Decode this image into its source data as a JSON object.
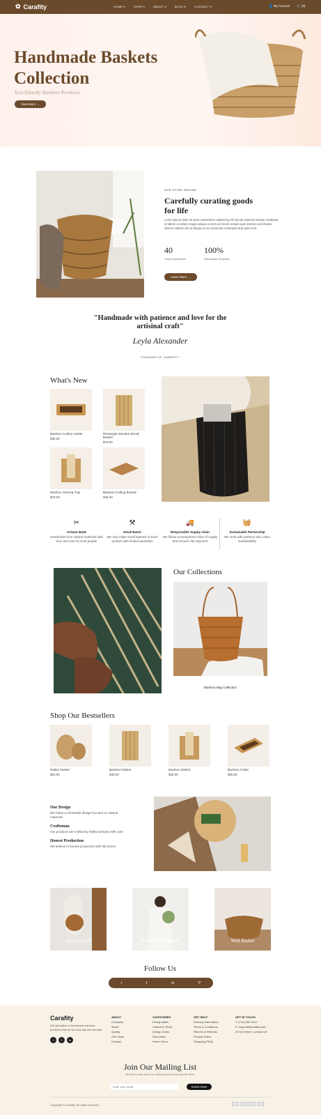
{
  "brand": "Carafity",
  "nav": [
    "HOME ▾",
    "SHOP ▾",
    "ABOUT ▾",
    "BLOG ▾",
    "CONTACT ▾"
  ],
  "header": {
    "account": "My Account",
    "cart": "(0)"
  },
  "hero": {
    "title": "Handmade Baskets Collection",
    "subtitle": "Eco-friendly Bamboo Products",
    "button": "View More →"
  },
  "about": {
    "kicker": "OUR STORY BEHIND",
    "title": "Carefully curating goods for life",
    "body": "Lorem ipsum dolor sit amet consectetur adipiscing elit sed do eiusmod tempor incididunt ut labore et dolore magna aliqua ut enim ad minim veniam quis nostrud exercitation ullamco laboris nisi ut aliquip ex ea commodo consequat duis aute irure.",
    "stat1": {
      "value": "40",
      "label": "Years Experience"
    },
    "stat2": {
      "value": "100%",
      "label": "Handmade Products"
    },
    "button": "Learn More →"
  },
  "quote": {
    "text": "\"Handmade with patience and love for the artisinal craft\"",
    "signature": "Leyla Alexander",
    "attribution": "FOUNDER OF CARAFITY"
  },
  "whats_new": {
    "title": "What's New",
    "items": [
      {
        "name": "Bamboo Cutlery Holder",
        "price": "$35.00"
      },
      {
        "name": "Rectangle Wooden Bread Basket",
        "price": "$78.00"
      },
      {
        "name": "Bamboo Serving Tray",
        "price": "$78.00"
      },
      {
        "name": "Bamboo Cutting Boards",
        "price": "$45.00"
      }
    ]
  },
  "features": [
    {
      "icon": "scissors-icon",
      "glyph": "✂",
      "title": "Artisan Made",
      "text": "Handmade from natural materials with love and care by local people"
    },
    {
      "icon": "tools-icon",
      "glyph": "⚒",
      "title": "Small Batch",
      "text": "We only make small batches of each product with limited quantities"
    },
    {
      "icon": "truck-icon",
      "glyph": "🚚",
      "title": "Responsible Supply chain",
      "text": "We follow a transparent chain of supply that ensures fair payment"
    },
    {
      "icon": "basket-icon",
      "glyph": "🧺",
      "title": "Sustainable Partnership",
      "text": "We work with partners who value sustainability"
    }
  ],
  "collections": {
    "title": "Our Collections",
    "caption": "Bamboo Bag Collection"
  },
  "bestsellers": {
    "title": "Shop Our Bestsellers",
    "items": [
      {
        "name": "Rattan basket",
        "price": "$24.00"
      },
      {
        "name": "Bamboo basket",
        "price": "$45.00"
      },
      {
        "name": "Bamboo basket",
        "price": "$45.00"
      },
      {
        "name": "Bamboo holder",
        "price": "$35.00"
      }
    ]
  },
  "values": [
    {
      "title": "Our Design",
      "text": "We follow a minimalist design focused on natural materials"
    },
    {
      "title": "Craftsman",
      "text": "Our products are crafted by skilled artisans with care"
    },
    {
      "title": "Honest Production",
      "text": "We believe in honest production with fair prices"
    }
  ],
  "categories": [
    "Home Decor",
    "Wooden Handmade",
    "Wall Basket"
  ],
  "follow": {
    "title": "Follow Us",
    "icons": [
      "t",
      "f",
      "in",
      "P"
    ]
  },
  "footer": {
    "brand": "Carafity",
    "about": "We specialize in handmade bamboo products that are eco-friendly and durable.",
    "cols": [
      {
        "title": "ABOUT",
        "links": [
          "Company",
          "About",
          "Quality",
          "Gift Cards",
          "Contact"
        ]
      },
      {
        "title": "CATEGORIES",
        "links": [
          "Dining tables",
          "Cabinet & Shelf",
          "Dining Chairs",
          "Decoration",
          "Home Decor"
        ]
      },
      {
        "title": "GET HELP",
        "links": [
          "Delivery Information",
          "Terms & Conditions",
          "Returns & Refunds",
          "Privacy Notice",
          "Shopping FAQs"
        ]
      },
      {
        "title": "GET IN TOUCH",
        "links": [
          "T: (+91) 555-3411",
          "E: support@carafity.com",
          "29 Old Street, London UK"
        ]
      }
    ]
  },
  "newsletter": {
    "title": "Join Our Mailing List",
    "sub": "Be first to hear about our latest products and special offers",
    "placeholder": "Enter your email",
    "button": "SUBSCRIBE"
  },
  "copyright": "Copyright © Carafity. All rights reserved."
}
